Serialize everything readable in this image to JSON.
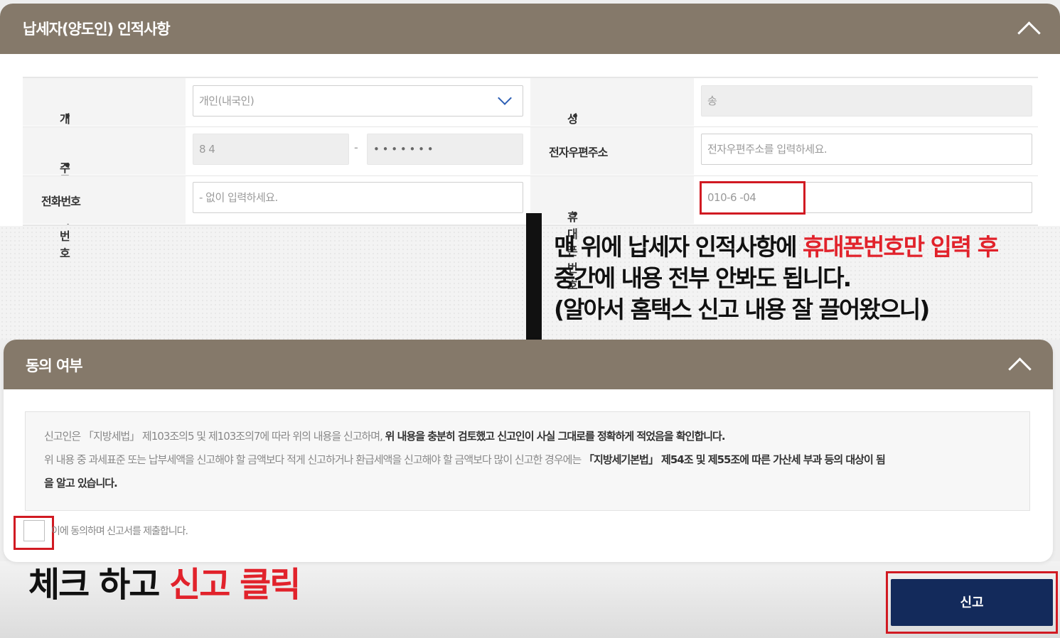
{
  "personal_info": {
    "title": "납세자(양도인) 인적사항",
    "fields": {
      "type_label": "개인구분",
      "type_value": "개인(내국인)",
      "name_label": "성명",
      "name_value": "송",
      "rrn_label": "주민등록번호",
      "rrn_front": "8    4",
      "rrn_back": "• • • • • • •",
      "rrn_separator": "-",
      "email_label": "전자우편주소",
      "email_placeholder": "전자우편주소를 입력하세요.",
      "phone_label": "전화번호",
      "phone_placeholder": "- 없이 입력하세요.",
      "mobile_label": "휴대폰번호",
      "mobile_value": "010-6      -04"
    },
    "required_mark": "•"
  },
  "annotation": {
    "line1_black": "맨 위에 납세자 인적사항에 ",
    "line1_red": "휴대폰번호만 입력 후",
    "line2": "중간에 내용 전부 안봐도 됩니다.",
    "line3": "(알아서 홈택스 신고 내용 잘 끌어왔으니)"
  },
  "consent": {
    "title": "동의 여부",
    "line1_normal": "신고인은 「지방세법」 제103조의5 및 제103조의7에 따라 위의 내용을 신고하며, ",
    "line1_bold": "위 내용을 충분히 검토했고 신고인이 사실 그대로를 정확하게 적었음을 확인합니다.",
    "line2_normal": "위 내용 중 과세표준 또는 납부세액을 신고해야 할 금액보다 적게 신고하거나 환급세액을 신고해야 할 금액보다 많이 신고한 경우에는 ",
    "line2_bold": "「지방세기본법」 제54조 및 제55조에 따른 가산세 부과 등의 대상이 됨",
    "line3_bold": "을 알고 있습니다.",
    "agree_label": "이에 동의하며 신고서를 제출합니다."
  },
  "bottom_annotation": {
    "black": "체크 하고 ",
    "red": "신고 클릭"
  },
  "submit_label": "신고",
  "colors": {
    "header_bg": "#85796a",
    "highlight_red": "#e1222b",
    "submit_bg": "#132a5b",
    "select_chevron": "#2d5fb5"
  }
}
